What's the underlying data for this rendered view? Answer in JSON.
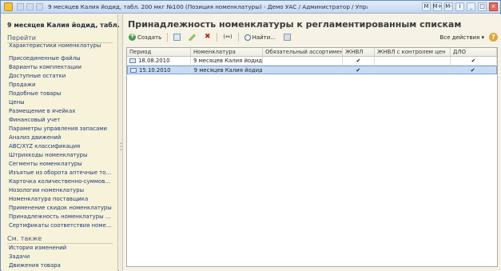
{
  "window": {
    "title": "9 месяцев Калия йодид, табл. 200 мкг №100 (Позиция номенклатуры) - Демо УАС / Администратор / Управ... (1С:Предприятие)",
    "title_right": [
      "M",
      "M+",
      "M-"
    ]
  },
  "sidebar": {
    "title": "9 месяцев Калия йодид, табл....",
    "go_to_label": "Перейти",
    "items": [
      {
        "label": "Характеристики номенклатуры"
      },
      {
        "label": "Присоединенные файлы"
      },
      {
        "label": "Варианты комплектации"
      },
      {
        "label": "Доступные остатки"
      },
      {
        "label": "Продажи"
      },
      {
        "label": "Подобные товары"
      },
      {
        "label": "Цены"
      },
      {
        "label": "Размещение в ячейках"
      },
      {
        "label": "Финансовый учет"
      },
      {
        "label": "Параметры управления запасами"
      },
      {
        "label": "Анализ движений"
      },
      {
        "label": "ABC/XYZ классификация"
      },
      {
        "label": "Штрихкоды номенклатуры"
      },
      {
        "label": "Сегменты номенклатуры"
      },
      {
        "label": "Изъятые из оборота аптечные това..."
      },
      {
        "label": "Карточка количественно-суммового..."
      },
      {
        "label": "Нозологии номенклатуры"
      },
      {
        "label": "Номенклатура поставщика"
      },
      {
        "label": "Применение скидок номенклатуры"
      },
      {
        "label": "Принадлежность номенклатуры к р..."
      },
      {
        "label": "Сертификаты соответствия номенк..."
      }
    ],
    "see_also_label": "См. также",
    "see_also": [
      {
        "label": "История изменений"
      },
      {
        "label": "Задачи"
      },
      {
        "label": "Движения товара"
      }
    ]
  },
  "main": {
    "title": "Принадлежность номенклатуры к регламентированным спискам",
    "toolbar": {
      "create_label": "Создать",
      "find_label": "Найти...",
      "all_actions_label": "Все действия",
      "period_glyph": "(↔)"
    },
    "table": {
      "columns": [
        "Период",
        "Номенклатура",
        "Обязательный ассортимент",
        "ЖНВЛ",
        "ЖНВЛ с контролем цен",
        "ДЛО"
      ],
      "check_glyph": "✔",
      "rows": [
        {
          "period": "18.08.2010",
          "item": "9 месяцев Калия йодид,...",
          "mandatory": "",
          "zhnvl": true,
          "zhnvl_price": false,
          "dlo": true,
          "selected": false
        },
        {
          "period": "15.10.2010",
          "item": "9 месяцев Калия йодид,...",
          "mandatory": "",
          "zhnvl": true,
          "zhnvl_price": false,
          "dlo": true,
          "selected": true
        }
      ]
    }
  }
}
